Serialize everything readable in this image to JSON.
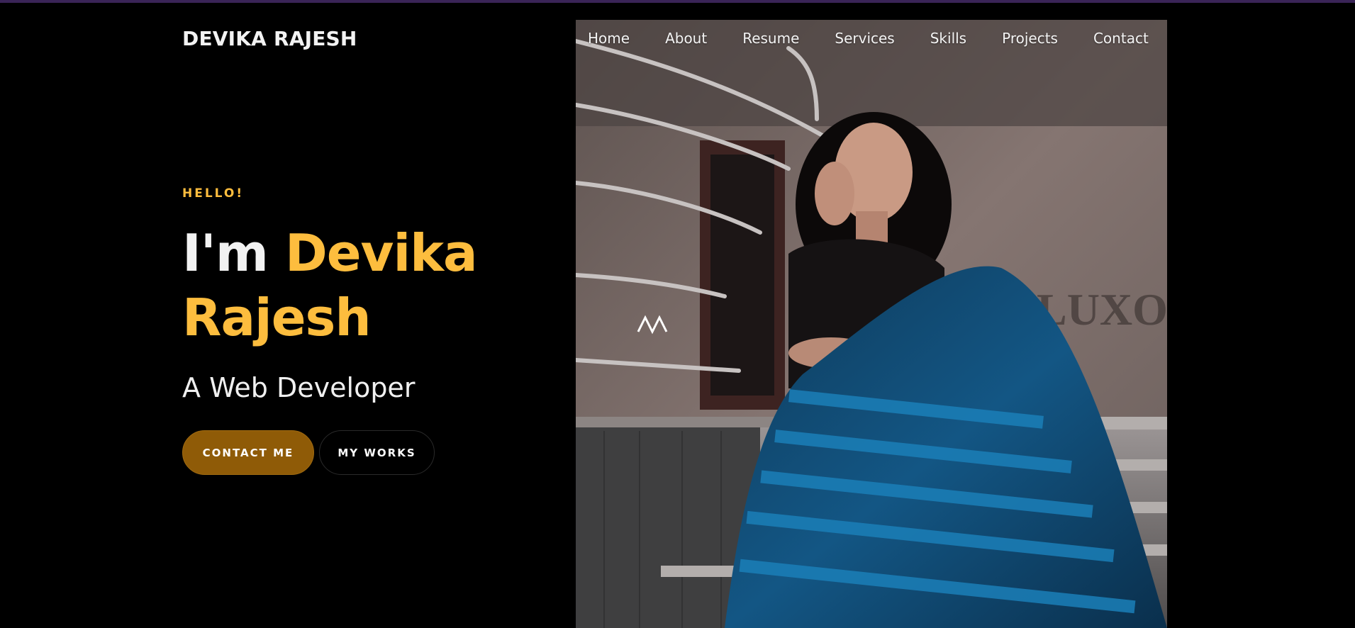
{
  "brand": {
    "name": "DEVIKA RAJESH"
  },
  "nav": {
    "items": [
      {
        "label": "Home"
      },
      {
        "label": "About"
      },
      {
        "label": "Resume"
      },
      {
        "label": "Services"
      },
      {
        "label": "Skills"
      },
      {
        "label": "Projects"
      },
      {
        "label": "Contact"
      }
    ]
  },
  "hero": {
    "greeting": "HELLO!",
    "headline_prefix": "I'm",
    "name_line1": "Devika",
    "name_line2": "Rajesh",
    "role": "A Web Developer",
    "primary_button": "CONTACT ME",
    "secondary_button": "MY WORKS",
    "photo_sign": "LUXO"
  },
  "colors": {
    "background": "#000000",
    "accent": "#fdbd3e",
    "primary_button": "#8f5b07",
    "top_bar": "#3a2457"
  }
}
